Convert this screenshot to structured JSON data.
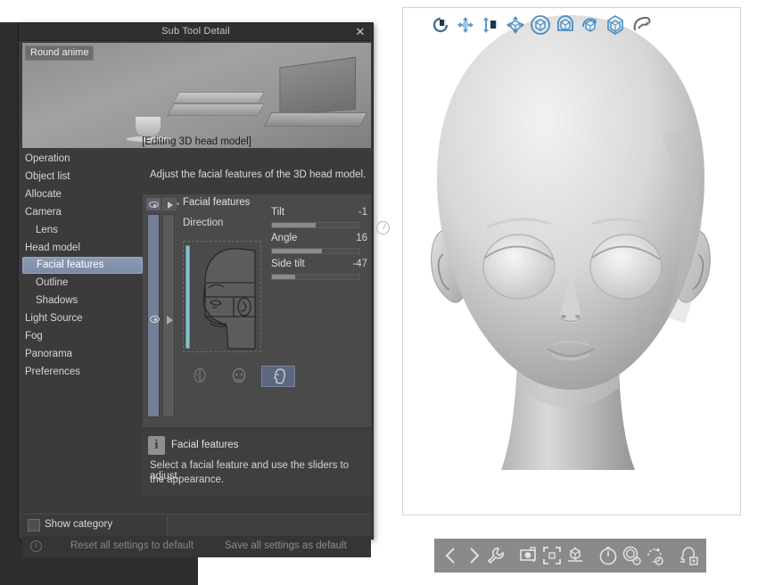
{
  "window": {
    "title": "Sub Tool Detail",
    "close_icon": "close-icon",
    "close_glyph": "✕"
  },
  "banner": {
    "tag": "Round anime",
    "caption": "[Editing 3D head model]"
  },
  "sidebar": {
    "items": [
      {
        "label": "Operation",
        "indent": false,
        "selected": false
      },
      {
        "label": "Object list",
        "indent": false,
        "selected": false
      },
      {
        "label": "Allocate",
        "indent": false,
        "selected": false
      },
      {
        "label": "Camera",
        "indent": false,
        "selected": false
      },
      {
        "label": "Lens",
        "indent": true,
        "selected": false
      },
      {
        "label": "Head model",
        "indent": false,
        "selected": false
      },
      {
        "label": "Facial features",
        "indent": true,
        "selected": true
      },
      {
        "label": "Outline",
        "indent": true,
        "selected": false
      },
      {
        "label": "Shadows",
        "indent": true,
        "selected": false
      },
      {
        "label": "Light Source",
        "indent": false,
        "selected": false
      },
      {
        "label": "Fog",
        "indent": false,
        "selected": false
      },
      {
        "label": "Panorama",
        "indent": false,
        "selected": false
      },
      {
        "label": "Preferences",
        "indent": false,
        "selected": false
      }
    ]
  },
  "content": {
    "description": "Adjust the facial features of the 3D head model.",
    "section_title": "Facial features",
    "direction_label": "Direction",
    "eye_icon": "eye-icon",
    "play_icon": "play-icon",
    "dial_icon": "dial-icon",
    "sliders": [
      {
        "name": "Tilt",
        "value": "-1",
        "fill_percent": 50
      },
      {
        "name": "Angle",
        "value": "16",
        "fill_percent": 57
      },
      {
        "name": "Side tilt",
        "value": "-47",
        "fill_percent": 27
      }
    ],
    "face_views": [
      {
        "name": "face-view-half",
        "selected": false
      },
      {
        "name": "face-view-front",
        "selected": false
      },
      {
        "name": "face-view-profile",
        "selected": true
      }
    ]
  },
  "info": {
    "icon": "info-icon",
    "icon_glyph": "i",
    "title": "Facial features",
    "line1": "Select a facial feature and use the sliders to adjust",
    "line2": "the appearance."
  },
  "footer": {
    "show_category_label": "Show category",
    "show_category_checked": false,
    "reset_label": "Reset all settings to default",
    "reset_icon": "reset-icon",
    "save_label": "Save all settings as default"
  },
  "toolbars": {
    "top": [
      {
        "name": "reset-pose-icon"
      },
      {
        "name": "move-xy-icon"
      },
      {
        "name": "move-z-icon"
      },
      {
        "name": "move-object-icon"
      },
      {
        "name": "rotate-object-icon"
      },
      {
        "name": "rotate-camera-icon"
      },
      {
        "name": "scale-object-icon"
      },
      {
        "name": "fit-object-icon"
      },
      {
        "name": "free-rotate-icon"
      }
    ],
    "bottom": [
      {
        "name": "prev-icon"
      },
      {
        "name": "next-icon"
      },
      {
        "name": "wrench-icon"
      },
      {
        "name": "camera-icon"
      },
      {
        "name": "fit-frame-icon"
      },
      {
        "name": "object-icon"
      },
      {
        "name": "timer-icon"
      },
      {
        "name": "cube-object-icon"
      },
      {
        "name": "rotate-reset-icon"
      },
      {
        "name": "add-head-icon"
      }
    ]
  },
  "colors": {
    "dialog_bg": "#3b3b3b",
    "panel_bg": "#4a4a4a",
    "selection": "#8b9bb5",
    "accent_cyan": "#87c3cf",
    "toolbar_blue": "#4a90c4",
    "viewport_bg": "#ffffff"
  }
}
